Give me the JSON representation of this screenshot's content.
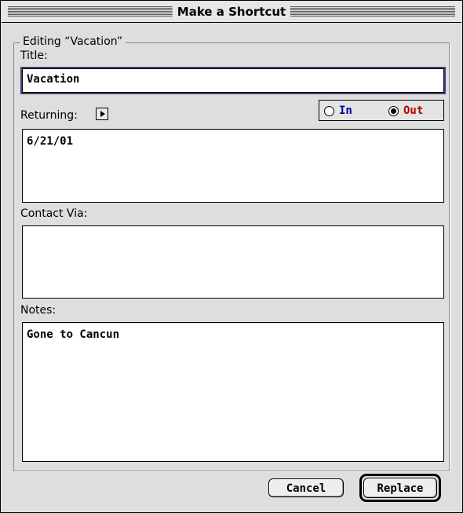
{
  "window": {
    "title": "Make a Shortcut"
  },
  "group": {
    "label": "Editing “Vacation”"
  },
  "title_field": {
    "label": "Title:",
    "value": "Vacation"
  },
  "returning": {
    "label": "Returning:",
    "value": "6/21/01"
  },
  "status": {
    "in": {
      "label": "In",
      "selected": false,
      "color": "#00008b"
    },
    "out": {
      "label": "Out",
      "selected": true,
      "color": "#b00000"
    }
  },
  "contact": {
    "label": "Contact Via:",
    "value": ""
  },
  "notes": {
    "label": "Notes:",
    "value": "Gone to Cancun"
  },
  "buttons": {
    "cancel": "Cancel",
    "replace": "Replace"
  }
}
